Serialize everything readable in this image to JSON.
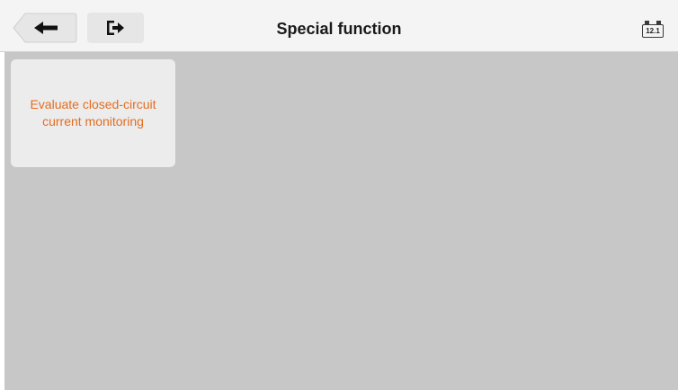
{
  "header": {
    "title": "Special function",
    "back_icon": "back-arrow-icon",
    "exit_icon": "exit-icon",
    "battery": {
      "icon": "battery-icon",
      "voltage": "12.1"
    }
  },
  "functions": [
    {
      "label": "Evaluate closed-circuit current monitoring"
    }
  ],
  "colors": {
    "accent": "#e56c1f",
    "content_bg": "#c7c7c7",
    "card_bg": "#ececec"
  }
}
